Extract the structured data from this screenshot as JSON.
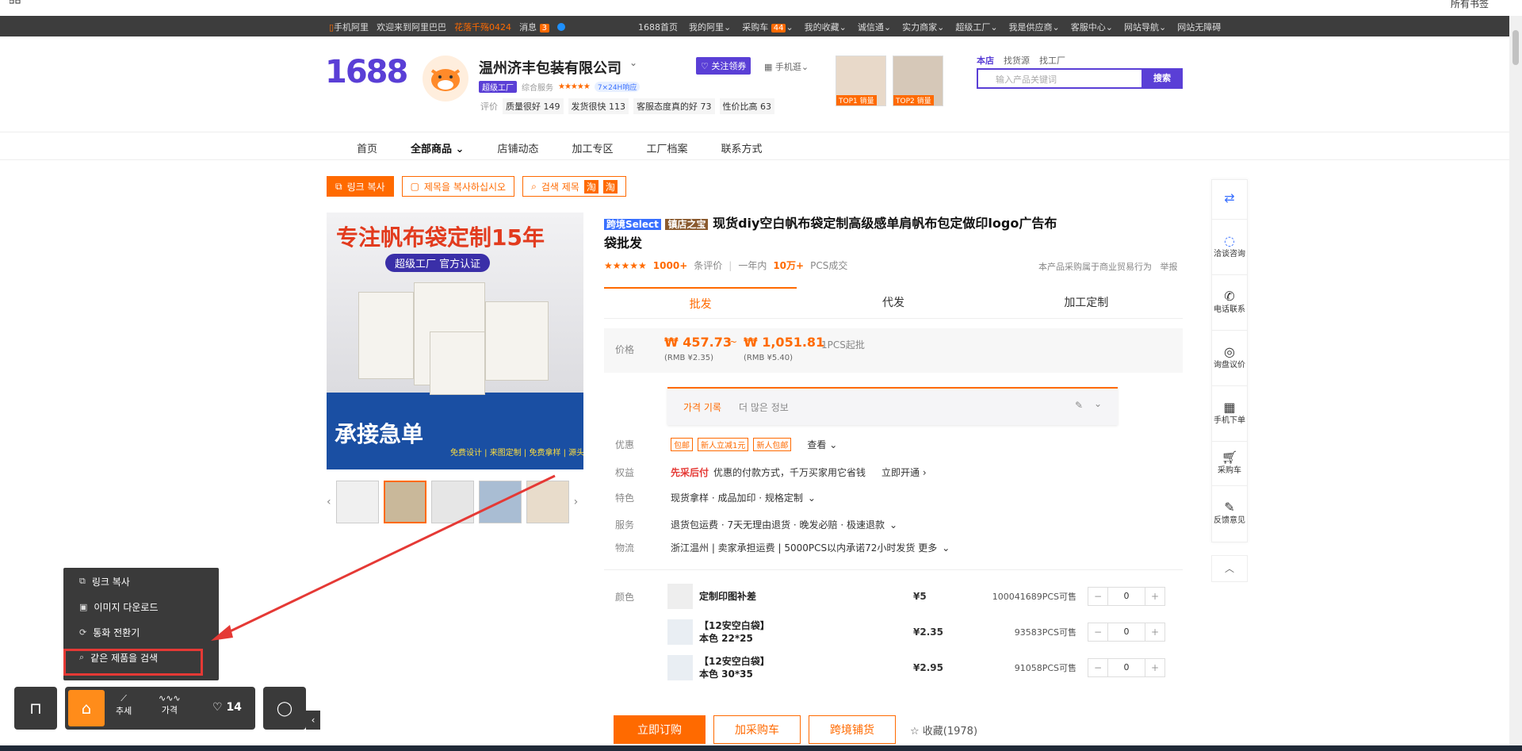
{
  "browser": {
    "right_text": "所有书签"
  },
  "topbar": {
    "mobile": "手机阿里",
    "welcome": "欢迎来到阿里巴巴",
    "user": "花落千殇0424",
    "messages": "消息",
    "message_count": "3",
    "links": [
      "1688首页",
      "我的阿里",
      "采购车",
      "我的收藏",
      "诚信通",
      "实力商家",
      "超级工厂",
      "我是供应商",
      "客服中心",
      "网站导航",
      "网站无障碍"
    ],
    "cart_count": "44"
  },
  "header": {
    "logo": "1688",
    "company": "温州济丰包装有限公司",
    "tag_factory": "超级工厂",
    "service_label": "综合服务",
    "stars": "★★★★★",
    "tag_response": "7×24H响应",
    "rating_label": "评价",
    "ratings": [
      "质量很好 149",
      "发货很快 113",
      "客服态度真的好 73",
      "性价比高 63"
    ],
    "follow": "关注领券",
    "mobile_shop": "手机逛",
    "top1": "TOP1 销量",
    "top2": "TOP2 销量",
    "search_tabs": [
      "本店",
      "找货源",
      "找工厂"
    ],
    "search_placeholder": "输入产品关键词",
    "search_button": "搜索"
  },
  "nav": {
    "items": [
      "首页",
      "全部商品",
      "店铺动态",
      "加工专区",
      "工厂档案",
      "联系方式"
    ]
  },
  "plugin": {
    "copy_link": "링크 복사",
    "copy_title": "제목을 복사하십시오",
    "search_title": "검색 제목"
  },
  "product": {
    "image_headline": "专注帆布袋定制15年",
    "image_badge": "超级工厂 官方认证",
    "image_footer": "承接急单",
    "image_footer_small": "免费设计 | 来图定制 | 免费拿样 | 源头工厂 | 量大价优",
    "tag_select": "跨境Select",
    "tag_shop": "镇店之宝",
    "title": "现货diy空白帆布袋定制高级感单肩帆布包定做印logo广告布袋批发",
    "stars": "★★★★★",
    "review_count": "1000+",
    "review_label": "条评价",
    "year_label": "一年内",
    "sold": "10万+",
    "sold_label": "PCS成交",
    "notice": "本产品采购属于商业贸易行为",
    "report": "举报",
    "tabs": [
      "批发",
      "代发",
      "加工定制"
    ],
    "price_label": "价格",
    "price_low": "₩ 457.73",
    "price_high": "₩ 1,051.81",
    "price_tilde": "~",
    "moq": "1PCS起批",
    "rmb_low": "(RMB ¥2.35)",
    "rmb_high": "(RMB ¥5.40)",
    "history_title": "가격 기록",
    "history_more": "더 많은 정보",
    "promo_label": "优惠",
    "promo_chips": [
      "包邮",
      "新人立减1元",
      "新人包邮"
    ],
    "promo_more": "查看",
    "rights_label": "权益",
    "rights_main": "先采后付",
    "rights_desc": "优惠的付款方式，千万买家用它省钱",
    "rights_action": "立即开通",
    "feature_label": "特色",
    "feature_value": "现货拿样 · 成品加印 · 规格定制",
    "service_label": "服务",
    "service_value": "退货包运费 · 7天无理由退货 · 晚发必赔 · 极速退款",
    "logistics_label": "物流",
    "logistics_value": "浙江温州 | 卖家承担运费 | 5000PCS以内承诺72小时发货 更多",
    "color_label": "颜色",
    "skus": [
      {
        "name": "定制印图补差",
        "sub": "",
        "price": "¥5",
        "stock": "100041689PCS可售",
        "qty": "0"
      },
      {
        "name": "【12安空白袋】",
        "sub": "本色 22*25",
        "price": "¥2.35",
        "stock": "93583PCS可售",
        "qty": "0"
      },
      {
        "name": "【12安空白袋】",
        "sub": "本色 30*35",
        "price": "¥2.95",
        "stock": "91058PCS可售",
        "qty": "0"
      }
    ],
    "btn_order": "立即订购",
    "btn_cart": "加采购车",
    "btn_cross": "跨境铺货",
    "favorite": "收藏(1978)"
  },
  "sidebar": [
    {
      "label": "",
      "icon": "translate-icon"
    },
    {
      "label": "洽谈咨询",
      "icon": "chat-icon"
    },
    {
      "label": "电话联系",
      "icon": "phone-icon"
    },
    {
      "label": "询盘议价",
      "icon": "target-icon"
    },
    {
      "label": "手机下单",
      "icon": "qr-icon"
    },
    {
      "label": "采购车",
      "icon": "cart-icon"
    },
    {
      "label": "反馈意见",
      "icon": "edit-icon"
    }
  ],
  "context_menu": [
    "링크 복사",
    "이미지 다운로드",
    "통화 전환기",
    "같은 제품을 검색"
  ],
  "dock": {
    "trend": "추세",
    "price": "가격",
    "likes": "14"
  }
}
